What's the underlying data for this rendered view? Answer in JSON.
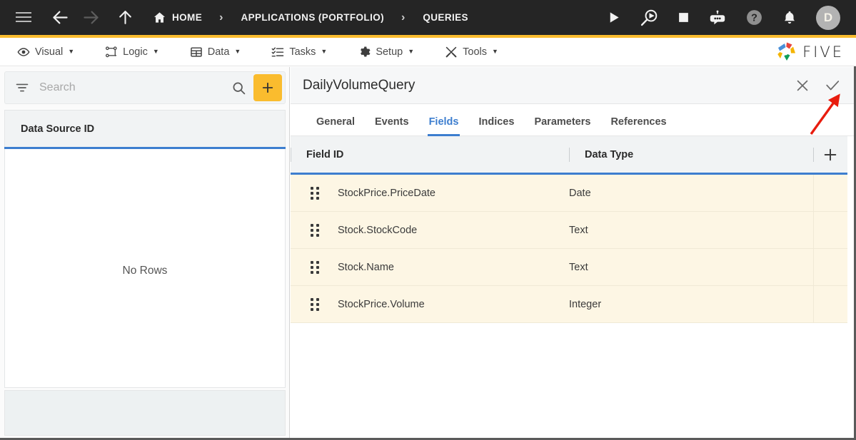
{
  "topbar": {
    "menu_icon": "hamburger-icon",
    "back_icon": "arrow-left-icon",
    "forward_icon": "arrow-right-icon",
    "up_icon": "arrow-up-icon",
    "home_icon": "home-icon",
    "breadcrumbs": [
      {
        "label": "HOME"
      },
      {
        "label": "APPLICATIONS (PORTFOLIO)"
      },
      {
        "label": "QUERIES"
      }
    ],
    "separator": "›",
    "actions": [
      {
        "name": "run-icon"
      },
      {
        "name": "debug-icon"
      },
      {
        "name": "stop-icon"
      },
      {
        "name": "chatbot-icon"
      },
      {
        "name": "help-icon"
      },
      {
        "name": "notifications-icon"
      }
    ],
    "avatar_initial": "D",
    "accent_color": "#fabc2e",
    "bg_color": "#252525"
  },
  "menubar": {
    "items": [
      {
        "label": "Visual",
        "icon": "eye-icon",
        "caret": "▼"
      },
      {
        "label": "Logic",
        "icon": "logic-nodes-icon",
        "caret": "▼"
      },
      {
        "label": "Data",
        "icon": "table-grid-icon",
        "caret": "▼"
      },
      {
        "label": "Tasks",
        "icon": "checklist-icon",
        "caret": "▼"
      },
      {
        "label": "Setup",
        "icon": "gear-icon",
        "caret": "▼"
      },
      {
        "label": "Tools",
        "icon": "wrench-screwdriver-icon",
        "caret": "▼"
      }
    ],
    "logo_text": "FIVE"
  },
  "left_panel": {
    "search": {
      "placeholder": "Search",
      "value": "",
      "filter_icon": "filter-icon",
      "search_icon": "search-icon"
    },
    "add_button": {
      "icon": "plus-icon",
      "color": "#fabc2e"
    },
    "grid": {
      "column_header": "Data Source ID",
      "empty_message": "No Rows",
      "rows": []
    },
    "accent_underline_color": "#3d7ecf"
  },
  "main_panel": {
    "title": "DailyVolumeQuery",
    "close_icon": "close-icon",
    "confirm_icon": "checkmark-icon",
    "tabs": [
      {
        "label": "General",
        "active": false
      },
      {
        "label": "Events",
        "active": false
      },
      {
        "label": "Fields",
        "active": true
      },
      {
        "label": "Indices",
        "active": false
      },
      {
        "label": "Parameters",
        "active": false
      },
      {
        "label": "References",
        "active": false
      }
    ],
    "active_tab_color": "#3d7ecf",
    "table": {
      "columns": [
        "Field ID",
        "Data Type"
      ],
      "add_row_icon": "plus-icon",
      "row_bg_color": "#fdf6e4",
      "rows": [
        {
          "field_id": "StockPrice.PriceDate",
          "data_type": "Date"
        },
        {
          "field_id": "Stock.StockCode",
          "data_type": "Text"
        },
        {
          "field_id": "Stock.Name",
          "data_type": "Text"
        },
        {
          "field_id": "StockPrice.Volume",
          "data_type": "Integer"
        }
      ]
    }
  },
  "annotation": {
    "arrow": "red-arrow-pointing-to-checkmark",
    "color": "#e81c0e"
  }
}
